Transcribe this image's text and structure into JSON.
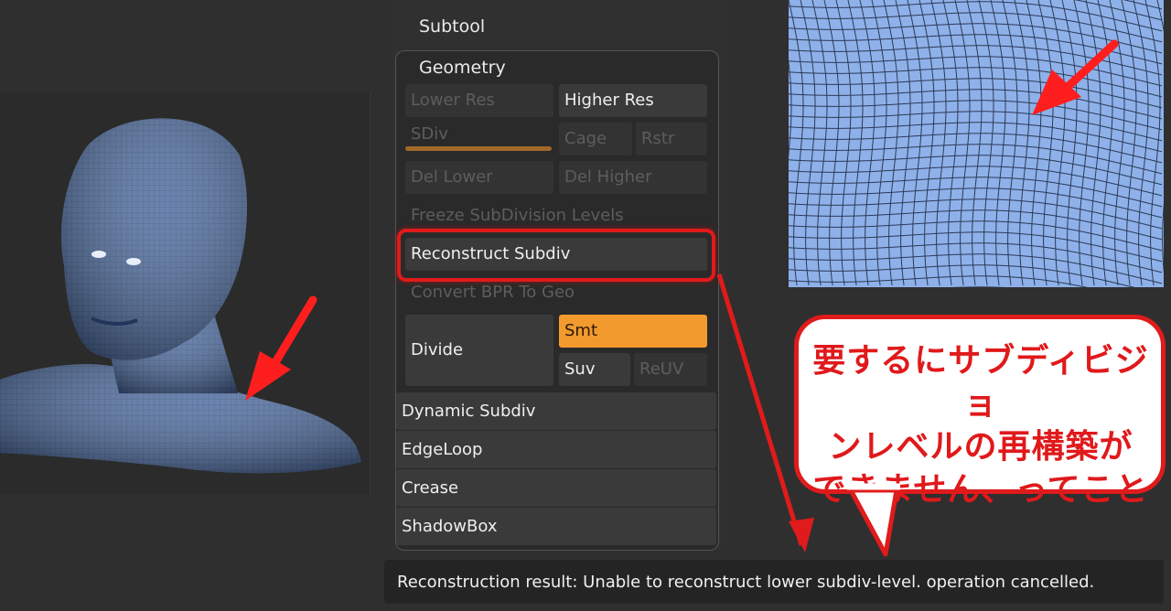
{
  "panel": {
    "subtool_label": "Subtool",
    "geometry_label": "Geometry",
    "buttons": {
      "lower_res": "Lower Res",
      "higher_res": "Higher Res",
      "sdiv": "SDiv",
      "cage": "Cage",
      "rstr": "Rstr",
      "del_lower": "Del Lower",
      "del_higher": "Del Higher",
      "freeze_subdivision": "Freeze SubDivision Levels",
      "reconstruct_subdiv": "Reconstruct Subdiv",
      "convert_bpr": "Convert BPR To Geo",
      "divide": "Divide",
      "smt": "Smt",
      "suv": "Suv",
      "reuv": "ReUV"
    },
    "sections": [
      "Dynamic Subdiv",
      "EdgeLoop",
      "Crease",
      "ShadowBox"
    ]
  },
  "status": {
    "message": "Reconstruction result: Unable to reconstruct lower subdiv-level. operation cancelled."
  },
  "bubble": {
    "lines": [
      "要するにサブディビジョ",
      "ンレベルの再構築が",
      "できません、ってこと"
    ]
  },
  "colors": {
    "accent_orange": "#f39a2e",
    "highlight_red": "#e01b1b",
    "mesh_blue": "#8fb1ea"
  }
}
